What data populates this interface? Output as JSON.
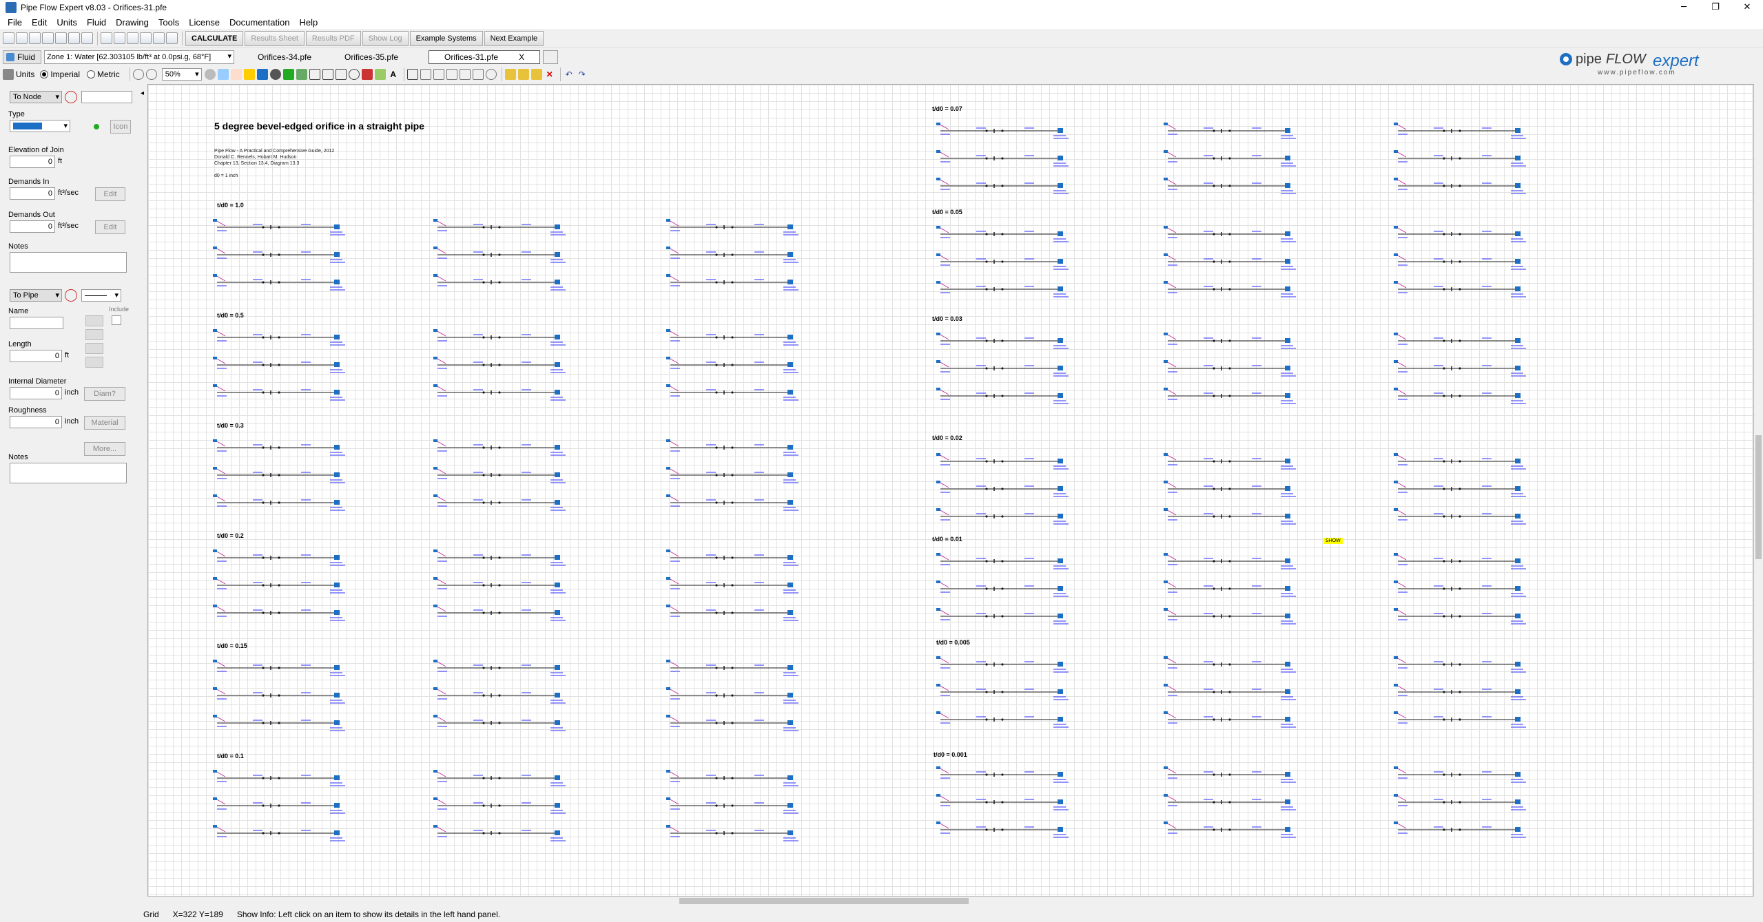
{
  "window": {
    "title": "Pipe Flow Expert v8.03 - Orifices-31.pfe",
    "minimize": "─",
    "restore": "❐",
    "close": "✕"
  },
  "menu": [
    "File",
    "Edit",
    "Units",
    "Fluid",
    "Drawing",
    "Tools",
    "License",
    "Documentation",
    "Help"
  ],
  "toolbar": {
    "calculate": "CALCULATE",
    "results_sheet": "Results Sheet",
    "results_pdf": "Results PDF",
    "show_log": "Show Log",
    "example_systems": "Example Systems",
    "next_example": "Next Example"
  },
  "fluid": {
    "button": "Fluid",
    "zone": "Zone 1: Water [62.303105 lb/ft³ at 0.0psi.g, 68°F]"
  },
  "tabs": [
    {
      "label": "Orifices-34.pfe"
    },
    {
      "label": "Orifices-35.pfe"
    },
    {
      "label": "Orifices-31.pfe",
      "close": "X",
      "active": true
    }
  ],
  "logo": {
    "brand_a": "pipe",
    "brand_b": "FLOW",
    "brand_c": "expert",
    "url": "www.pipeflow.com"
  },
  "units": {
    "label": "Units",
    "imperial": "Imperial",
    "metric": "Metric",
    "selected": "Imperial"
  },
  "zoom": "50%",
  "left_panel": {
    "node_select": "To Node",
    "type_label": "Type",
    "icon_btn": "Icon",
    "elevation_label": "Elevation of Join",
    "elevation_value": "0",
    "elevation_unit": "ft",
    "demands_in_label": "Demands In",
    "demands_in_value": "0",
    "demands_in_unit": "ft³/sec",
    "edit": "Edit",
    "demands_out_label": "Demands Out",
    "demands_out_value": "0",
    "demands_out_unit": "ft³/sec",
    "notes_label": "Notes",
    "pipe_select": "To Pipe",
    "include_label": "Include",
    "name_label": "Name",
    "length_label": "Length",
    "length_value": "0",
    "length_unit": "ft",
    "internal_diameter_label": "Internal Diameter",
    "internal_diameter_value": "0",
    "internal_diameter_unit": "inch",
    "diam_btn": "Diam?",
    "roughness_label": "Roughness",
    "roughness_value": "0",
    "roughness_unit": "inch",
    "material_btn": "Material",
    "more_btn": "More...",
    "notes2_label": "Notes"
  },
  "canvas": {
    "title": "5 degree bevel-edged orifice in a straight pipe",
    "ref_lines": [
      "Pipe Flow - A Practical and Comprehensive Guide, 2012",
      "Donald C. Rennels, Hobart M. Hudson",
      "Chapter 13, Section 13.4, Diagram 13.3",
      "",
      "d0 = 1 inch"
    ],
    "left_groups": [
      "t/d0 = 1.0",
      "t/d0 = 0.5",
      "t/d0 = 0.3",
      "t/d0 = 0.2",
      "t/d0 = 0.15",
      "t/d0 = 0.1"
    ],
    "right_groups": [
      "t/d0 = 0.07",
      "t/d0 = 0.05",
      "t/d0 = 0.03",
      "t/d0 = 0.02",
      "t/d0 = 0.01",
      "t/d0 = 0.005",
      "t/d0 = 0.001"
    ],
    "show_tag": "SHOW"
  },
  "status": {
    "grid": "Grid",
    "coords": "X=322  Y=189",
    "info": "Show Info: Left click on an item to show its details in the left hand panel."
  },
  "colors": {
    "pipe": "#1a1a1a",
    "label": "#4d4dff",
    "tank": "#1c6fc4",
    "accent": "#c02090"
  }
}
